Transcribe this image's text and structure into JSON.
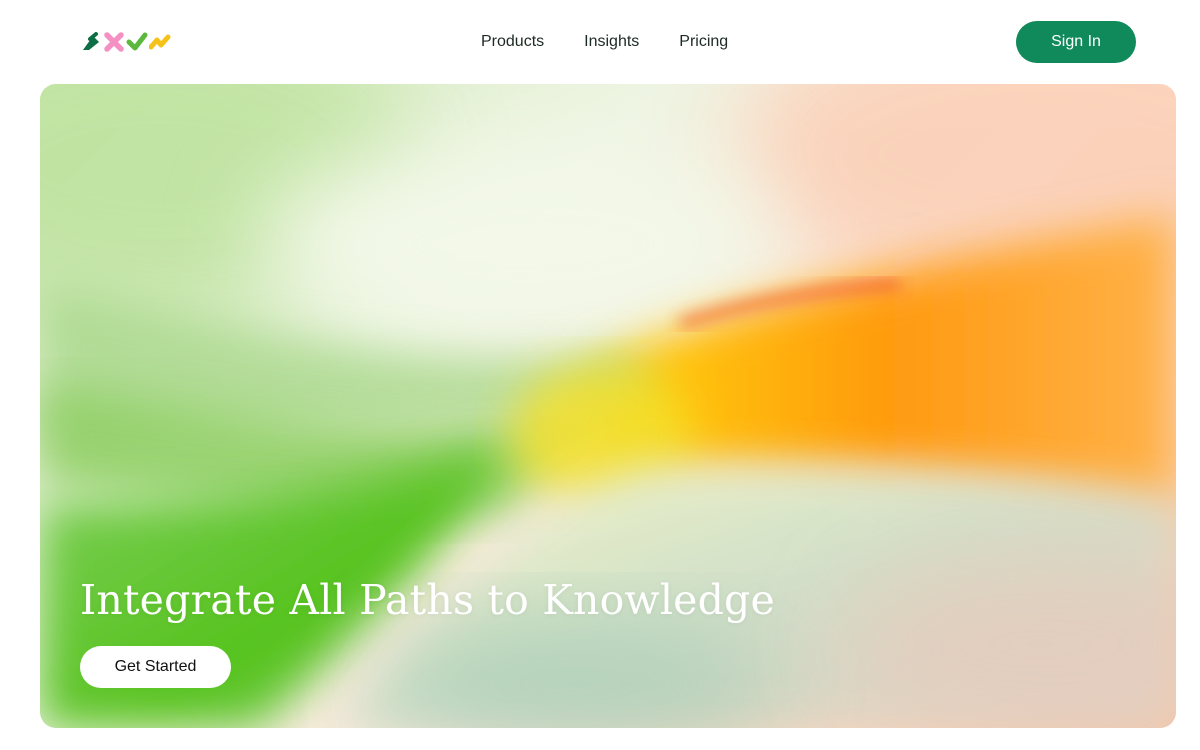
{
  "brand": {
    "logo_icons": [
      "green-leaf-icon",
      "pink-x-icon",
      "lime-check-icon",
      "yellow-zigzag-icon"
    ],
    "colors": {
      "primary": "#118a5b",
      "pink": "#f490c4",
      "lime": "#6bc34a",
      "yellow": "#f5c21a",
      "dark_green": "#0e6e45"
    }
  },
  "nav": {
    "items": [
      {
        "label": "Products"
      },
      {
        "label": "Insights"
      },
      {
        "label": "Pricing"
      }
    ]
  },
  "header": {
    "signin_label": "Sign In"
  },
  "hero": {
    "title": "Integrate All Paths to Knowledge",
    "cta_label": "Get Started"
  }
}
